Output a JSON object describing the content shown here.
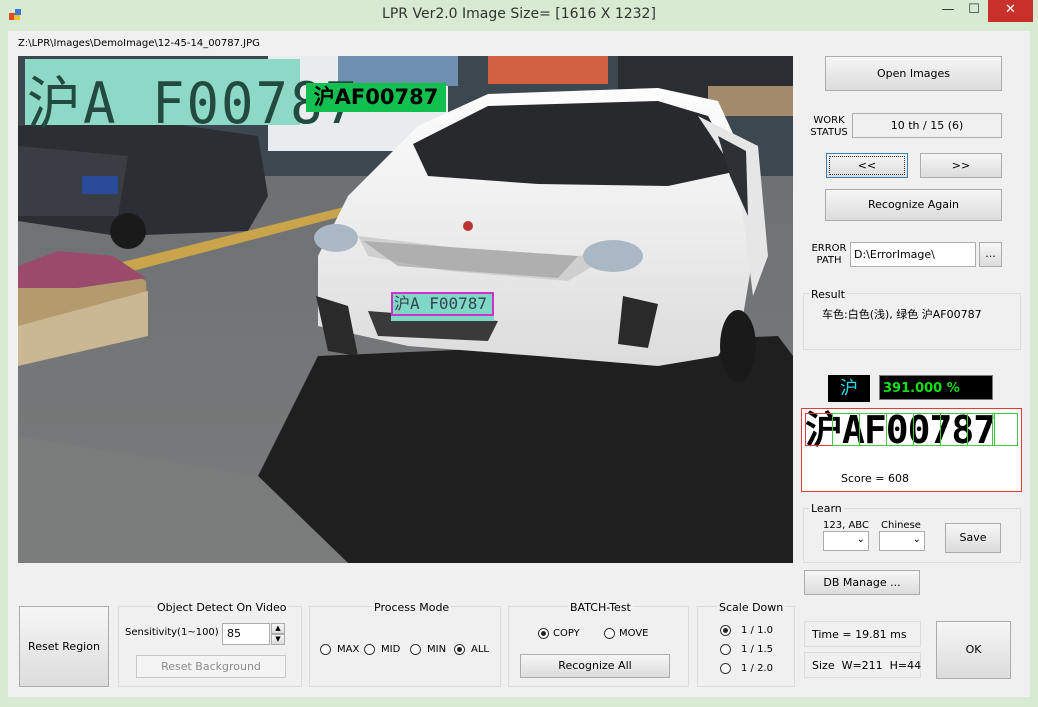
{
  "window": {
    "title": "LPR Ver2.0 Image Size= [1616 X 1232]",
    "minimize_glyph": "—",
    "maximize_glyph": "☐",
    "close_glyph": "✕"
  },
  "image_path": "Z:\\LPR\\Images\\DemoImage\\12-45-14_00787.JPG",
  "image_overlay": {
    "plate_crop_text": "沪A F00787",
    "recognized_tag": "沪AF00787",
    "detected_plate_text": "沪A F00787"
  },
  "right_panel": {
    "open_images_label": "Open Images",
    "work_status_label": "WORK\nSTATUS",
    "work_status_value": "10 th / 15 (6)",
    "prev_label": "<<",
    "next_label": ">>",
    "recognize_again_label": "Recognize Again",
    "error_path_label": "ERROR\nPATH",
    "error_path_value": "D:\\ErrorImage\\",
    "browse_label": "...",
    "result_label": "Result",
    "result_text": "车色:白色(浅), 绿色 沪AF00787",
    "province_char": "沪",
    "confidence": "391.000 %",
    "plate_chars": "沪AF00787",
    "score_text": "Score = 608",
    "learn_label": "Learn",
    "learn_abc_label": "123, ABC",
    "learn_chinese_label": "Chinese",
    "save_label": "Save",
    "db_manage_label": "DB Manage ...",
    "time_text": "Time = 19.81 ms",
    "size_text": "Size  W=211  H=44",
    "ok_label": "OK"
  },
  "bottom": {
    "reset_region_label": "Reset Region",
    "object_detect_label": "Object Detect On Video",
    "sensitivity_label": "Sensitivity(1~100)",
    "sensitivity_value": "85",
    "reset_background_label": "Reset Background",
    "process_mode_label": "Process Mode",
    "process_modes": [
      "MAX",
      "MID",
      "MIN",
      "ALL"
    ],
    "process_mode_selected": "ALL",
    "batch_label": "BATCH-Test",
    "batch_copy_label": "COPY",
    "batch_move_label": "MOVE",
    "batch_selected": "COPY",
    "recognize_all_label": "Recognize All",
    "scale_down_label": "Scale Down",
    "scale_options": [
      "1 / 1.0",
      "1 / 1.5",
      "1 / 2.0"
    ],
    "scale_selected": "1 / 1.0"
  }
}
